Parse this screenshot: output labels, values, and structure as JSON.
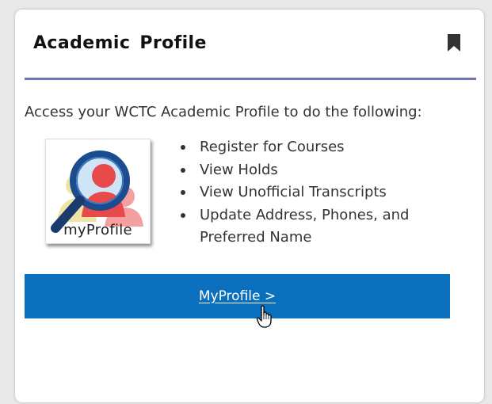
{
  "card": {
    "title": "Academic Profile",
    "bookmark_icon": "bookmark-icon",
    "divider_color": "#7175b4"
  },
  "content": {
    "intro": "Access your WCTC Academic Profile to do the following:",
    "logo": {
      "icon": "magnifier-people-icon",
      "text": "myProfile"
    },
    "tasks": [
      "Register for Courses",
      "View Holds",
      "View Unofficial Transcripts",
      "Update Address, Phones, and Preferred Name"
    ]
  },
  "cta": {
    "label": "MyProfile >",
    "color": "#0a70bd",
    "text_color": "#ffffff"
  },
  "cursor": {
    "icon": "hand-pointer-icon"
  }
}
